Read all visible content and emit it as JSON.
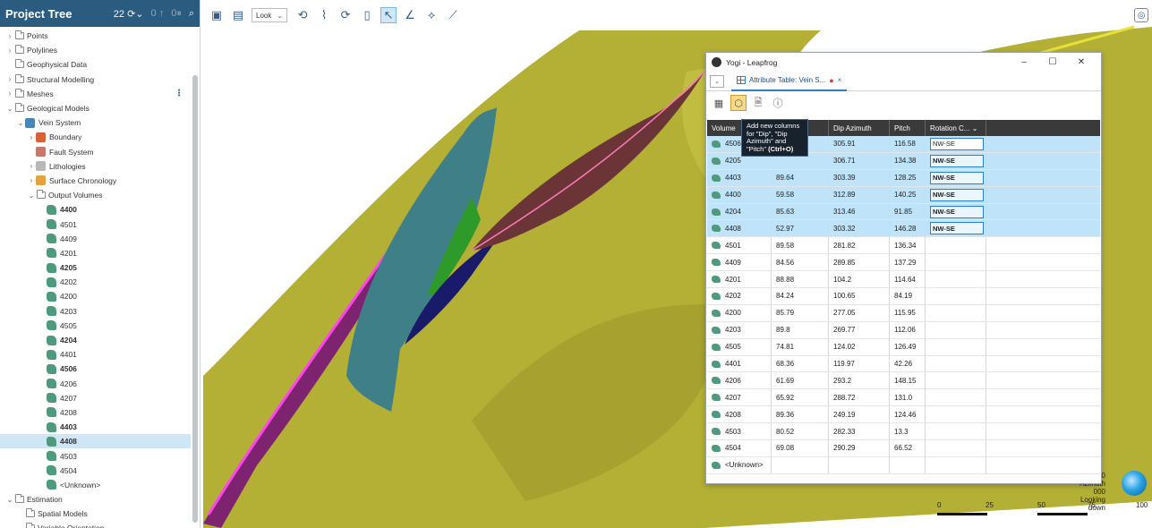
{
  "tree": {
    "title": "Project Tree",
    "header_controls": [
      "22",
      "0",
      "0"
    ],
    "items": [
      {
        "label": "Points",
        "level": 0,
        "chev": "›",
        "icon": "folder"
      },
      {
        "label": "Polylines",
        "level": 0,
        "chev": "›",
        "icon": "folder"
      },
      {
        "label": "Geophysical Data",
        "level": 0,
        "chev": "",
        "icon": "folder"
      },
      {
        "label": "Structural Modelling",
        "level": 0,
        "chev": "›",
        "icon": "folder"
      },
      {
        "label": "Meshes",
        "level": 0,
        "chev": "›",
        "icon": "folder",
        "menu": "⋮"
      },
      {
        "label": "Geological Models",
        "level": 0,
        "chev": "⌄",
        "icon": "folder"
      },
      {
        "label": "Vein System",
        "level": 1,
        "chev": "⌄",
        "icon": "vein"
      },
      {
        "label": "Boundary",
        "level": 2,
        "chev": "›",
        "icon": "boundary"
      },
      {
        "label": "Fault System",
        "level": 2,
        "chev": "",
        "icon": "fault"
      },
      {
        "label": "Lithologies",
        "level": 2,
        "chev": "›",
        "icon": "lith"
      },
      {
        "label": "Surface Chronology",
        "level": 2,
        "chev": "›",
        "icon": "chron"
      },
      {
        "label": "Output Volumes",
        "level": 2,
        "chev": "⌄",
        "icon": "folder"
      },
      {
        "label": "4400",
        "level": 3,
        "chev": "",
        "icon": "vol",
        "bold": true
      },
      {
        "label": "4501",
        "level": 3,
        "chev": "",
        "icon": "vol"
      },
      {
        "label": "4409",
        "level": 3,
        "chev": "",
        "icon": "vol"
      },
      {
        "label": "4201",
        "level": 3,
        "chev": "",
        "icon": "vol"
      },
      {
        "label": "4205",
        "level": 3,
        "chev": "",
        "icon": "vol",
        "bold": true
      },
      {
        "label": "4202",
        "level": 3,
        "chev": "",
        "icon": "vol"
      },
      {
        "label": "4200",
        "level": 3,
        "chev": "",
        "icon": "vol"
      },
      {
        "label": "4203",
        "level": 3,
        "chev": "",
        "icon": "vol"
      },
      {
        "label": "4505",
        "level": 3,
        "chev": "",
        "icon": "vol"
      },
      {
        "label": "4204",
        "level": 3,
        "chev": "",
        "icon": "vol",
        "bold": true
      },
      {
        "label": "4401",
        "level": 3,
        "chev": "",
        "icon": "vol"
      },
      {
        "label": "4506",
        "level": 3,
        "chev": "",
        "icon": "vol",
        "bold": true
      },
      {
        "label": "4206",
        "level": 3,
        "chev": "",
        "icon": "vol"
      },
      {
        "label": "4207",
        "level": 3,
        "chev": "",
        "icon": "vol"
      },
      {
        "label": "4208",
        "level": 3,
        "chev": "",
        "icon": "vol"
      },
      {
        "label": "4403",
        "level": 3,
        "chev": "",
        "icon": "vol",
        "bold": true
      },
      {
        "label": "4408",
        "level": 3,
        "chev": "",
        "icon": "vol",
        "bold": true,
        "selected": true
      },
      {
        "label": "4503",
        "level": 3,
        "chev": "",
        "icon": "vol"
      },
      {
        "label": "4504",
        "level": 3,
        "chev": "",
        "icon": "vol"
      },
      {
        "label": "<Unknown>",
        "level": 3,
        "chev": "",
        "icon": "vol"
      },
      {
        "label": "Estimation",
        "level": 0,
        "chev": "⌄",
        "icon": "folder"
      },
      {
        "label": "Spatial Models",
        "level": 1,
        "chev": "",
        "icon": "folder"
      },
      {
        "label": "Variable Orientation",
        "level": 1,
        "chev": "",
        "icon": "folder"
      }
    ]
  },
  "viewer": {
    "mode_select": "Look",
    "compass": {
      "line1": "90",
      "line2": "Azimuth 000",
      "line3": "Looking down"
    },
    "scale_labels": [
      "0",
      "25",
      "50",
      "75",
      "100"
    ]
  },
  "window": {
    "title": "Yogi - Leapfrog",
    "controls": [
      "–",
      "☐",
      "✕"
    ],
    "tab_label": "Attribute Table: Vein S...",
    "tab_modified": "●",
    "tab_close": "×",
    "tooltip": {
      "text": "Add new columns for \"Dip\", \"Dip Azimuth\" and \"Pitch\"",
      "shortcut": "(Ctrl+O)"
    },
    "columns": [
      "Volume",
      "Dip",
      "Dip Azimuth",
      "Pitch",
      "Rotation C...",
      ""
    ],
    "rows": [
      {
        "volume": "4506",
        "dip": "",
        "azimuth": "305.91",
        "pitch": "116.58",
        "rotation": "NW-SE",
        "sel": true,
        "first": true
      },
      {
        "volume": "4205",
        "dip": "",
        "azimuth": "306.71",
        "pitch": "134.38",
        "rotation": "NW-SE",
        "sel": true
      },
      {
        "volume": "4403",
        "dip": "89.64",
        "azimuth": "303.39",
        "pitch": "128.25",
        "rotation": "NW-SE",
        "sel": true
      },
      {
        "volume": "4400",
        "dip": "59.58",
        "azimuth": "312.89",
        "pitch": "140.25",
        "rotation": "NW-SE",
        "sel": true
      },
      {
        "volume": "4204",
        "dip": "85.63",
        "azimuth": "313.46",
        "pitch": "91.85",
        "rotation": "NW-SE",
        "sel": true
      },
      {
        "volume": "4408",
        "dip": "52.97",
        "azimuth": "303.32",
        "pitch": "146.28",
        "rotation": "NW-SE",
        "sel": true
      },
      {
        "volume": "4501",
        "dip": "89.58",
        "azimuth": "281.82",
        "pitch": "136.34",
        "rotation": ""
      },
      {
        "volume": "4409",
        "dip": "84.56",
        "azimuth": "289.85",
        "pitch": "137.29",
        "rotation": ""
      },
      {
        "volume": "4201",
        "dip": "88.88",
        "azimuth": "104.2",
        "pitch": "114.64",
        "rotation": ""
      },
      {
        "volume": "4202",
        "dip": "84.24",
        "azimuth": "100.65",
        "pitch": "84.19",
        "rotation": ""
      },
      {
        "volume": "4200",
        "dip": "85.79",
        "azimuth": "277.05",
        "pitch": "115.95",
        "rotation": ""
      },
      {
        "volume": "4203",
        "dip": "89.8",
        "azimuth": "269.77",
        "pitch": "112.06",
        "rotation": ""
      },
      {
        "volume": "4505",
        "dip": "74.81",
        "azimuth": "124.02",
        "pitch": "126.49",
        "rotation": ""
      },
      {
        "volume": "4401",
        "dip": "68.36",
        "azimuth": "119.97",
        "pitch": "42.26",
        "rotation": ""
      },
      {
        "volume": "4206",
        "dip": "61.69",
        "azimuth": "293.2",
        "pitch": "148.15",
        "rotation": ""
      },
      {
        "volume": "4207",
        "dip": "65.92",
        "azimuth": "288.72",
        "pitch": "131.0",
        "rotation": ""
      },
      {
        "volume": "4208",
        "dip": "89.36",
        "azimuth": "249.19",
        "pitch": "124.46",
        "rotation": ""
      },
      {
        "volume": "4503",
        "dip": "80.52",
        "azimuth": "282.33",
        "pitch": "13.3",
        "rotation": ""
      },
      {
        "volume": "4504",
        "dip": "69.08",
        "azimuth": "290.29",
        "pitch": "66.52",
        "rotation": ""
      },
      {
        "volume": "<Unknown>",
        "dip": "",
        "azimuth": "",
        "pitch": "",
        "rotation": ""
      }
    ]
  },
  "colors": {
    "header_bg": "#2b5b7f",
    "surface_olive": "#b7b23a",
    "selection": "#bfe3f8",
    "accent": "#2b7fd0"
  }
}
